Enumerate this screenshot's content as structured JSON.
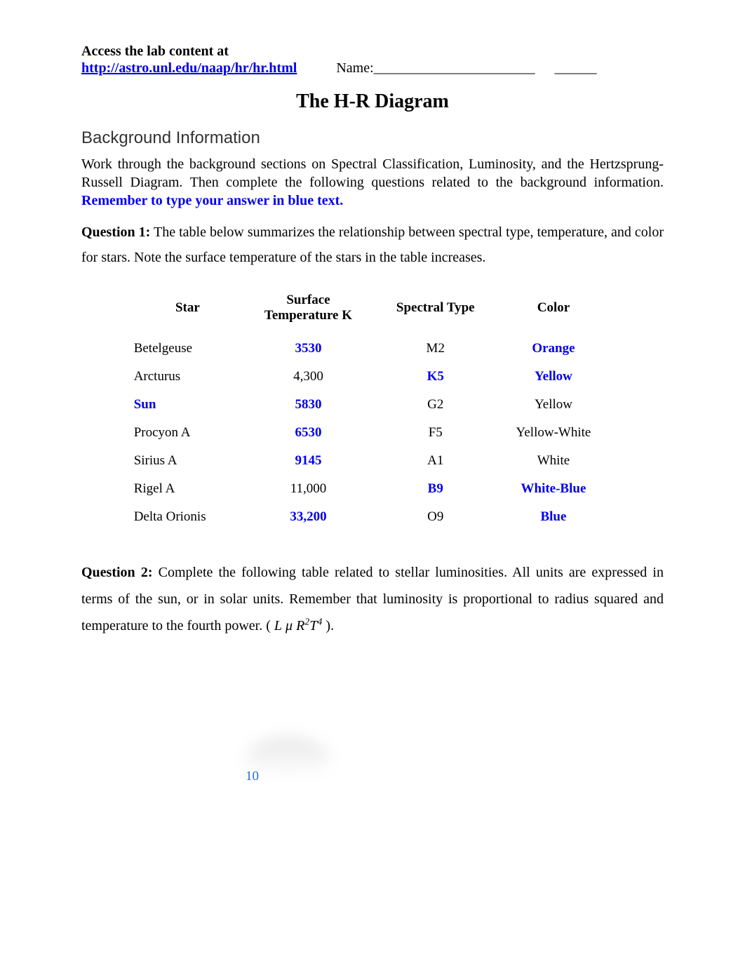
{
  "header": {
    "access_text": "Access the lab content at",
    "url": "http://astro.unl.edu/naap/hr/hr.html",
    "name_label": "Name:",
    "name_blank": "_______________________",
    "name_blank2": "______"
  },
  "title": "The H-R Diagram",
  "section1": {
    "heading": "Background Information",
    "intro_pre": "Work through the background sections on Spectral Classification, Luminosity, and the Hertzsprung-Russell Diagram. Then complete the following questions related to the background information.  ",
    "reminder": "Remember to type your answer in blue text."
  },
  "q1": {
    "label": "Question 1:",
    "text": " The table below summarizes the relationship between spectral type, temperature, and color for stars.  Note the surface temperature of the stars in the table increases."
  },
  "table": {
    "headers": {
      "star": "Star",
      "temp1": "Surface",
      "temp2": "Temperature K",
      "spectral": "Spectral Type",
      "color": "Color"
    },
    "rows": [
      {
        "star": "Betelgeuse",
        "star_blue": false,
        "temp": "3530",
        "temp_blue": true,
        "spec": "M2",
        "spec_blue": false,
        "color": "Orange",
        "color_blue": true
      },
      {
        "star": "Arcturus",
        "star_blue": false,
        "temp": "4,300",
        "temp_blue": false,
        "spec": "K5",
        "spec_blue": true,
        "color": "Yellow",
        "color_blue": true
      },
      {
        "star": "Sun",
        "star_blue": true,
        "temp": "5830",
        "temp_blue": true,
        "spec": "G2",
        "spec_blue": false,
        "color": "Yellow",
        "color_blue": false
      },
      {
        "star": "Procyon A",
        "star_blue": false,
        "temp": "6530",
        "temp_blue": true,
        "spec": "F5",
        "spec_blue": false,
        "color": "Yellow-White",
        "color_blue": false
      },
      {
        "star": "Sirius A",
        "star_blue": false,
        "temp": "9145",
        "temp_blue": true,
        "spec": "A1",
        "spec_blue": false,
        "color": "White",
        "color_blue": false
      },
      {
        "star": "Rigel A",
        "star_blue": false,
        "temp": "11,000",
        "temp_blue": false,
        "spec": "B9",
        "spec_blue": true,
        "color": "White-Blue",
        "color_blue": true
      },
      {
        "star": "Delta Orionis",
        "star_blue": false,
        "temp": "33,200",
        "temp_blue": true,
        "spec": "O9",
        "spec_blue": false,
        "color": "Blue",
        "color_blue": true
      }
    ]
  },
  "q2": {
    "label": "Question 2:",
    "text_a": " Complete the following table related to stellar luminosities.  All units are expressed in terms of the sun, or in solar units.  Remember that luminosity is proportional to radius squared and temperature to the fourth power. ("
  },
  "footer_num": "10"
}
